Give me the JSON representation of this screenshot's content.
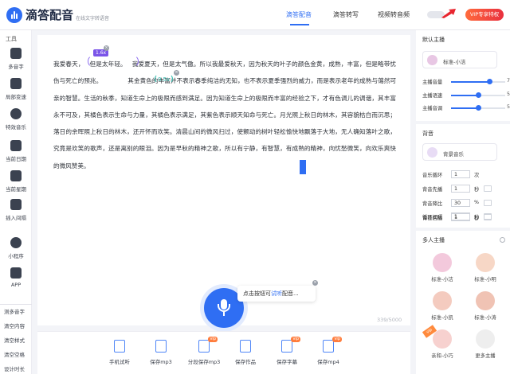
{
  "app": {
    "name": "滴答配音",
    "tagline": "在线文字转语音"
  },
  "nav": {
    "tabs": [
      {
        "label": "滴答配音",
        "active": true
      },
      {
        "label": "滴答转写",
        "active": false
      },
      {
        "label": "视频转音频",
        "active": false
      }
    ],
    "vip_button": "VIP专享特权"
  },
  "sidebar": {
    "title": "工具",
    "items": [
      {
        "label": "多音字",
        "icon": "polyphone-icon"
      },
      {
        "label": "局部变速",
        "icon": "speed-icon"
      },
      {
        "label": "特效音乐",
        "icon": "music-icon"
      },
      {
        "label": "当前日期",
        "icon": "calendar-icon"
      },
      {
        "label": "当前星期",
        "icon": "week-icon"
      },
      {
        "label": "插入间隔",
        "icon": "interval-icon"
      },
      {
        "label": "小程序",
        "icon": "miniprogram-icon"
      },
      {
        "label": "APP",
        "icon": "app-icon"
      }
    ],
    "bottom": [
      "测多音字",
      "清空内容",
      "清空样式",
      "清空空格",
      "设计时长"
    ]
  },
  "editor": {
    "speed_badge": "1.6x",
    "pause_badge": "0.5s",
    "segments": {
      "s1": "我爱春天，",
      "s2": "但是太年轻。",
      "s3": "我爱夏天，但是太气傲。所以我最爱秋天，因为秋天的叶子的颜色金黄，成熟，丰富，但是略带忧伤与死亡的预兆。",
      "s4": "其金黄色的丰富并不表示春季纯洁的无知，也不表示夏季强烈的威力，而是表示老年的成熟与蔼然可亲的智慧。生活的秋季，知道生命上的极限而感到满足。因为知道生命上的极限而丰富的经验之下，才有色调儿的调谐，其丰富永不可及，其橘色表示生命与力量，其橘色表示满足，其紫色表示顺天知命与死亡。月光照上秋日的林木，其容貌枯白而沉思；落日的余晖照上秋日的林木，还开怀而欢笑。清晨山间的微风扫过，使颤动的树叶轻松愉快地飘落于大地，无人确知落叶之歌，究竟是欢笑的歌声，还是离别的眼泪。因为是早秋的精神之歌，所以有宁静，有智慧，有成熟的精神，向忧愁微笑，向",
      "s5": "欢乐爽快的微风赞美。"
    },
    "counter": "339/5000",
    "mic_tip_pre": "点击按钮可",
    "mic_tip_link": "试听",
    "mic_tip_post": "配音..."
  },
  "toolbar": [
    {
      "label": "手机试听",
      "icon": "phone-icon",
      "vip": ""
    },
    {
      "label": "保存mp3",
      "icon": "mp3-file-icon",
      "vip": ""
    },
    {
      "label": "分段保存mp3",
      "icon": "split-save-icon",
      "vip": "vip"
    },
    {
      "label": "保存作品",
      "icon": "save-work-icon",
      "vip": ""
    },
    {
      "label": "保存字幕",
      "icon": "subtitle-icon",
      "vip": "vip"
    },
    {
      "label": "保存mp4",
      "icon": "mp4-file-icon",
      "vip": "vip"
    }
  ],
  "voice_panel": {
    "title": "默认主播",
    "voice": "标准-小洁",
    "sliders": [
      {
        "label": "主播音量",
        "value": "7",
        "fraction": 0.7
      },
      {
        "label": "主播语速",
        "value": "5",
        "fraction": 0.5
      },
      {
        "label": "主播音调",
        "value": "5",
        "fraction": 0.5
      }
    ]
  },
  "bgm_panel": {
    "title": "背音",
    "music": "背景音乐",
    "fields": [
      {
        "label": "音乐循环",
        "value": "1",
        "unit": "次"
      },
      {
        "label": "背音先播",
        "value": "1",
        "unit": "秒"
      },
      {
        "label": "背音降比",
        "value": "30",
        "unit": "%"
      },
      {
        "label": "背音后播",
        "value": "1",
        "unit": "秒"
      },
      {
        "label": "循环间隔",
        "value": "1",
        "unit": "秒"
      }
    ]
  },
  "multi_panel": {
    "title": "多人主播",
    "voices": [
      {
        "name": "标准-小洁",
        "color": "#f3c9dc"
      },
      {
        "name": "标准-小明",
        "color": "#f7d7c6"
      },
      {
        "name": "标准-小凯",
        "color": "#f4cbbf"
      },
      {
        "name": "标准-小涛",
        "color": "#f0c3b4"
      },
      {
        "name": "亲和-小巧",
        "color": "#f7d1cf",
        "vip": "vip"
      },
      {
        "name": "更多主播",
        "color": "#eeeeee"
      }
    ]
  },
  "colors": {
    "accent": "#2f6ef3",
    "vip": "#e9303e"
  }
}
